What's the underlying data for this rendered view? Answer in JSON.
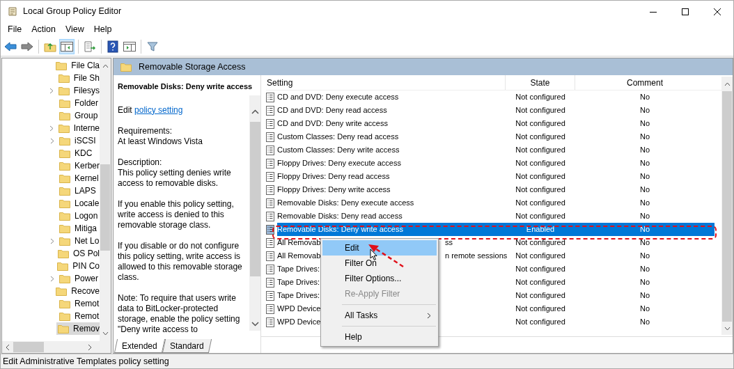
{
  "window": {
    "title": "Local Group Policy Editor"
  },
  "menu": [
    "File",
    "Action",
    "View",
    "Help"
  ],
  "tree": {
    "items": [
      {
        "label": "File Cla",
        "expandable": false,
        "selected": false
      },
      {
        "label": "File Sh",
        "expandable": false,
        "selected": false
      },
      {
        "label": "Filesys",
        "expandable": true,
        "selected": false
      },
      {
        "label": "Folder",
        "expandable": false,
        "selected": false
      },
      {
        "label": "Group",
        "expandable": false,
        "selected": false
      },
      {
        "label": "Interne",
        "expandable": true,
        "selected": false
      },
      {
        "label": "iSCSI",
        "expandable": true,
        "selected": false
      },
      {
        "label": "KDC",
        "expandable": false,
        "selected": false
      },
      {
        "label": "Kerber",
        "expandable": false,
        "selected": false
      },
      {
        "label": "Kernel",
        "expandable": false,
        "selected": false
      },
      {
        "label": "LAPS",
        "expandable": false,
        "selected": false
      },
      {
        "label": "Locale",
        "expandable": false,
        "selected": false
      },
      {
        "label": "Logon",
        "expandable": false,
        "selected": false
      },
      {
        "label": "Mitiga",
        "expandable": false,
        "selected": false
      },
      {
        "label": "Net Lo",
        "expandable": true,
        "selected": false
      },
      {
        "label": "OS Pol",
        "expandable": false,
        "selected": false
      },
      {
        "label": "PIN Co",
        "expandable": false,
        "selected": false
      },
      {
        "label": "Power",
        "expandable": true,
        "selected": false
      },
      {
        "label": "Recove",
        "expandable": false,
        "selected": false
      },
      {
        "label": "Remot",
        "expandable": false,
        "selected": false
      },
      {
        "label": "Remot",
        "expandable": false,
        "selected": false
      },
      {
        "label": "Remov",
        "expandable": false,
        "selected": true
      }
    ]
  },
  "panel_header": "Removable Storage Access",
  "description": {
    "title": "Removable Disks: Deny write access",
    "edit_prefix": "Edit",
    "edit_link": "policy setting",
    "paragraphs": [
      "Requirements:\nAt least Windows Vista",
      "Description:\nThis policy setting denies write access to removable disks.",
      "If you enable this policy setting, write access is denied to this removable storage class.",
      "If you disable or do not configure this policy setting, write access is allowed to this removable storage class.",
      "Note: To require that users write data to BitLocker-protected storage, enable the policy setting \"Deny write access to"
    ]
  },
  "tabs": [
    {
      "label": "Extended",
      "selected": true
    },
    {
      "label": "Standard",
      "selected": false
    }
  ],
  "table": {
    "columns": [
      "Setting",
      "State",
      "Comment"
    ],
    "rows": [
      {
        "setting": "CD and DVD: Deny execute access",
        "state": "Not configured",
        "comment": "No",
        "selected": false
      },
      {
        "setting": "CD and DVD: Deny read access",
        "state": "Not configured",
        "comment": "No",
        "selected": false
      },
      {
        "setting": "CD and DVD: Deny write access",
        "state": "Not configured",
        "comment": "No",
        "selected": false
      },
      {
        "setting": "Custom Classes: Deny read access",
        "state": "Not configured",
        "comment": "No",
        "selected": false
      },
      {
        "setting": "Custom Classes: Deny write access",
        "state": "Not configured",
        "comment": "No",
        "selected": false
      },
      {
        "setting": "Floppy Drives: Deny execute access",
        "state": "Not configured",
        "comment": "No",
        "selected": false
      },
      {
        "setting": "Floppy Drives: Deny read access",
        "state": "Not configured",
        "comment": "No",
        "selected": false
      },
      {
        "setting": "Floppy Drives: Deny write access",
        "state": "Not configured",
        "comment": "No",
        "selected": false
      },
      {
        "setting": "Removable Disks: Deny execute access",
        "state": "Not configured",
        "comment": "No",
        "selected": false
      },
      {
        "setting": "Removable Disks: Deny read access",
        "state": "Not configured",
        "comment": "No",
        "selected": false
      },
      {
        "setting": "Removable Disks: Deny write access",
        "state": "Enabled",
        "comment": "No",
        "selected": true
      },
      {
        "setting": "All Removab",
        "setting_tail": "ss",
        "state": "Not configured",
        "comment": "No",
        "selected": false
      },
      {
        "setting": "All Removab",
        "setting_tail": "n remote sessions",
        "state": "Not configured",
        "comment": "No",
        "selected": false
      },
      {
        "setting": "Tape Drives:",
        "state": "Not configured",
        "comment": "No",
        "selected": false
      },
      {
        "setting": "Tape Drives:",
        "state": "Not configured",
        "comment": "No",
        "selected": false
      },
      {
        "setting": "Tape Drives:",
        "state": "Not configured",
        "comment": "No",
        "selected": false
      },
      {
        "setting": "WPD Device",
        "state": "Not configured",
        "comment": "No",
        "selected": false
      },
      {
        "setting": "WPD Device",
        "state": "Not configured",
        "comment": "No",
        "selected": false
      }
    ]
  },
  "context_menu": [
    {
      "kind": "item",
      "label": "Edit",
      "selected": true,
      "disabled": false
    },
    {
      "kind": "item",
      "label": "Filter On",
      "selected": false,
      "disabled": false
    },
    {
      "kind": "item",
      "label": "Filter Options...",
      "selected": false,
      "disabled": false
    },
    {
      "kind": "item",
      "label": "Re-Apply Filter",
      "selected": false,
      "disabled": true
    },
    {
      "kind": "separator"
    },
    {
      "kind": "submenu",
      "label": "All Tasks",
      "selected": false,
      "disabled": false
    },
    {
      "kind": "separator"
    },
    {
      "kind": "item",
      "label": "Help",
      "selected": false,
      "disabled": false
    }
  ],
  "status_bar": "Edit Administrative Templates policy setting"
}
